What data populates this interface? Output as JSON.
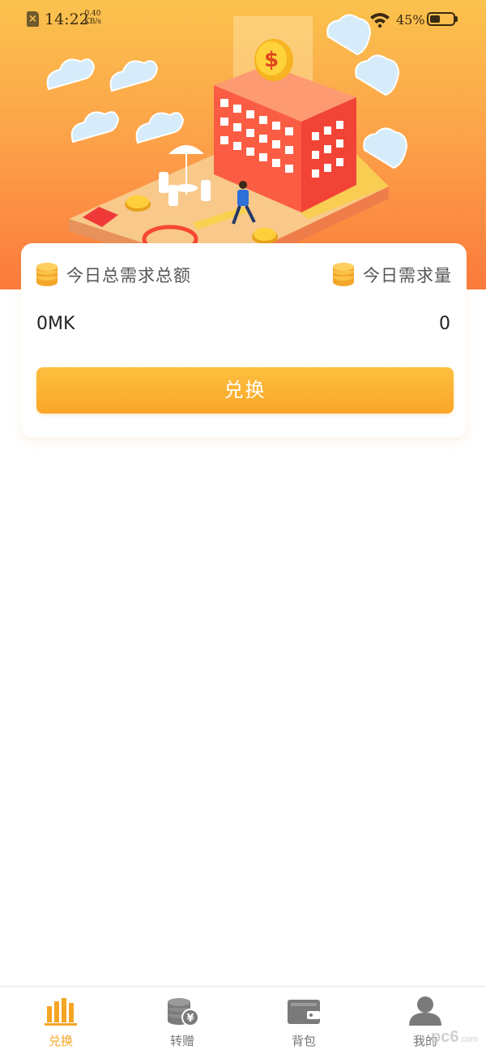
{
  "status_bar": {
    "time": "14:22",
    "speed_value": "0.40",
    "speed_unit": "KB/s",
    "battery_percent": "45%",
    "battery_level": 0.45
  },
  "stats": {
    "left": {
      "icon": "coins-icon",
      "label": "今日总需求总额",
      "value": "0MK"
    },
    "right": {
      "icon": "coins-icon",
      "label": "今日需求量",
      "value": "0"
    }
  },
  "exchange_button": {
    "label": "兑换"
  },
  "bottom_nav": {
    "items": [
      {
        "label": "兑换",
        "icon": "bar-chart-icon",
        "active": true
      },
      {
        "label": "转赠",
        "icon": "coins-yuan-icon",
        "active": false
      },
      {
        "label": "背包",
        "icon": "wallet-icon",
        "active": false
      },
      {
        "label": "我的",
        "icon": "user-icon",
        "active": false
      }
    ]
  },
  "colors": {
    "accent": "#fbaa2c",
    "active_nav": "#f5a524",
    "inactive_nav": "#777777",
    "hero_top": "#fbc24d",
    "hero_bottom": "#fb7a3c"
  },
  "watermark": {
    "main": "pc6",
    "sub": ".com"
  }
}
